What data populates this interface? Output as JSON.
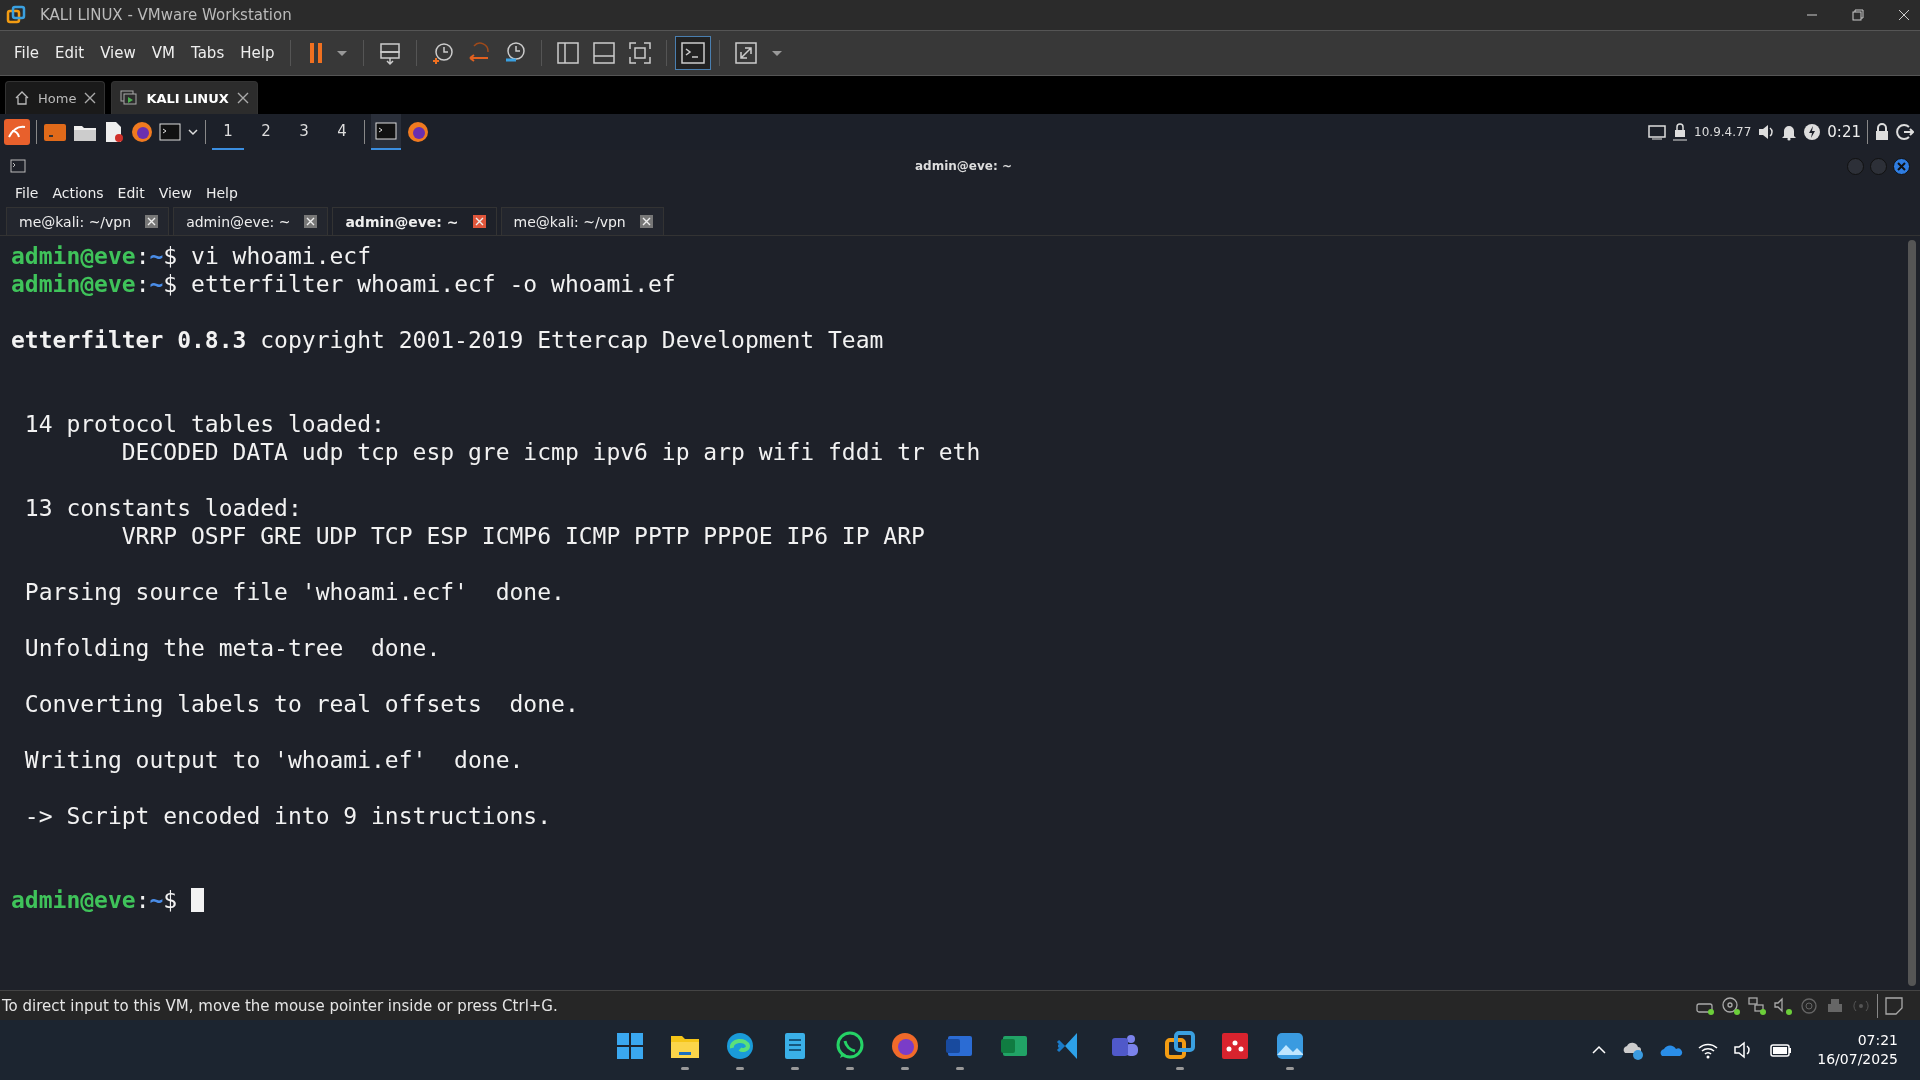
{
  "window": {
    "title": "KALI LINUX - VMware Workstation"
  },
  "menu": [
    "File",
    "Edit",
    "View",
    "VM",
    "Tabs",
    "Help"
  ],
  "vm_tabs": [
    {
      "label": "Home",
      "selected": false,
      "kind": "home"
    },
    {
      "label": "KALI LINUX",
      "selected": true,
      "kind": "vm"
    }
  ],
  "kali_panel": {
    "workspaces": [
      {
        "label": "1",
        "selected": true
      },
      {
        "label": "2",
        "selected": false
      },
      {
        "label": "3",
        "selected": false
      },
      {
        "label": "4",
        "selected": false
      }
    ],
    "ip": "10.9.4.77",
    "timer": "0:21"
  },
  "terminal": {
    "title": "admin@eve: ~",
    "menu": [
      "File",
      "Actions",
      "Edit",
      "View",
      "Help"
    ],
    "tabs": [
      {
        "label": "me@kali: ~/vpn",
        "selected": false
      },
      {
        "label": "admin@eve: ~",
        "selected": false
      },
      {
        "label": "admin@eve: ~",
        "selected": true
      },
      {
        "label": "me@kali: ~/vpn",
        "selected": false
      }
    ],
    "lines": [
      {
        "kind": "prompt",
        "user": "admin@eve",
        "separator": ":",
        "path": "~",
        "symbol": "$",
        "command": " vi whoami.ecf"
      },
      {
        "kind": "prompt",
        "user": "admin@eve",
        "separator": ":",
        "path": "~",
        "symbol": "$",
        "command": " etterfilter whoami.ecf -o whoami.ef"
      },
      {
        "kind": "blank"
      },
      {
        "kind": "text",
        "text": "**etterfilter 0.8.3** copyright 2001-2019 Ettercap Development Team"
      },
      {
        "kind": "blank"
      },
      {
        "kind": "blank"
      },
      {
        "kind": "text",
        "text": " 14 protocol tables loaded:"
      },
      {
        "kind": "text",
        "text": "        DECODED DATA udp tcp esp gre icmp ipv6 ip arp wifi fddi tr eth"
      },
      {
        "kind": "blank"
      },
      {
        "kind": "text",
        "text": " 13 constants loaded:"
      },
      {
        "kind": "text",
        "text": "        VRRP OSPF GRE UDP TCP ESP ICMP6 ICMP PPTP PPPOE IP6 IP ARP"
      },
      {
        "kind": "blank"
      },
      {
        "kind": "text",
        "text": " Parsing source file 'whoami.ecf'  done."
      },
      {
        "kind": "blank"
      },
      {
        "kind": "text",
        "text": " Unfolding the meta-tree  done."
      },
      {
        "kind": "blank"
      },
      {
        "kind": "text",
        "text": " Converting labels to real offsets  done."
      },
      {
        "kind": "blank"
      },
      {
        "kind": "text",
        "text": " Writing output to 'whoami.ef'  done."
      },
      {
        "kind": "blank"
      },
      {
        "kind": "text",
        "text": " -> Script encoded into 9 instructions."
      },
      {
        "kind": "blank"
      },
      {
        "kind": "blank"
      },
      {
        "kind": "prompt",
        "user": "admin@eve",
        "separator": ":",
        "path": "~",
        "symbol": "$ ",
        "cursor": true
      }
    ]
  },
  "status_bar": {
    "message": "To direct input to this VM, move the mouse pointer inside or press Ctrl+G."
  },
  "taskbar": {
    "apps": [
      {
        "kind": "start",
        "running": false
      },
      {
        "kind": "folder",
        "running": true
      },
      {
        "kind": "browser",
        "running": true
      },
      {
        "kind": "notepad",
        "running": true
      },
      {
        "kind": "chat",
        "running": true
      },
      {
        "kind": "fox",
        "running": true
      },
      {
        "kind": "document",
        "running": true
      },
      {
        "kind": "spreadsheet",
        "running": false
      },
      {
        "kind": "code",
        "running": false
      },
      {
        "kind": "people",
        "running": false
      },
      {
        "kind": "squares",
        "running": true
      },
      {
        "kind": "tile",
        "running": false
      },
      {
        "kind": "image",
        "running": true
      }
    ],
    "time": "07:21",
    "date": "16/07/2025"
  }
}
